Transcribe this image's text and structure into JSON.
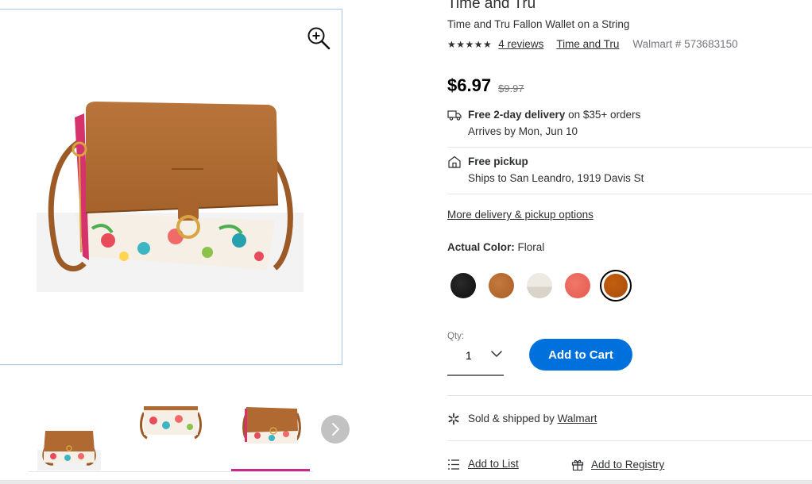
{
  "product": {
    "brand_heading": "Time and Tru",
    "title": "Time and Tru Fallon Wallet on a String",
    "stars": "★★★★★",
    "reviews": "4 reviews",
    "brand_link": "Time and Tru",
    "item_number": "Walmart # 573683150"
  },
  "price": {
    "current": "$6.97",
    "was": "$9.97"
  },
  "fulfillment": {
    "delivery_bold": "Free 2-day delivery",
    "delivery_rest": " on $35+ orders",
    "delivery_arrives": "Arrives by Mon, Jun 10",
    "pickup_bold": "Free pickup",
    "pickup_location": "Ships to San Leandro, 1919 Davis St",
    "more_options": "More delivery & pickup options"
  },
  "color": {
    "label": "Actual Color:",
    "value": " Floral",
    "swatches": [
      {
        "name": "black",
        "color": "#151515"
      },
      {
        "name": "cognac",
        "color": "#b96b30"
      },
      {
        "name": "cream",
        "color": "#e6e1da"
      },
      {
        "name": "coral",
        "color": "#e96a5d"
      },
      {
        "name": "floral",
        "color": "#b85409",
        "selected": true
      }
    ]
  },
  "quantity": {
    "label": "Qty:",
    "value": "1"
  },
  "cart": {
    "add_to_cart": "Add to Cart"
  },
  "seller": {
    "prefix": "Sold & shipped by ",
    "name": "Walmart"
  },
  "actions": {
    "add_to_list": "Add to List",
    "add_to_registry": "Add to Registry"
  },
  "colors": {
    "accent_blue": "#0071dc",
    "thumb_underline": "#c72a8f"
  }
}
